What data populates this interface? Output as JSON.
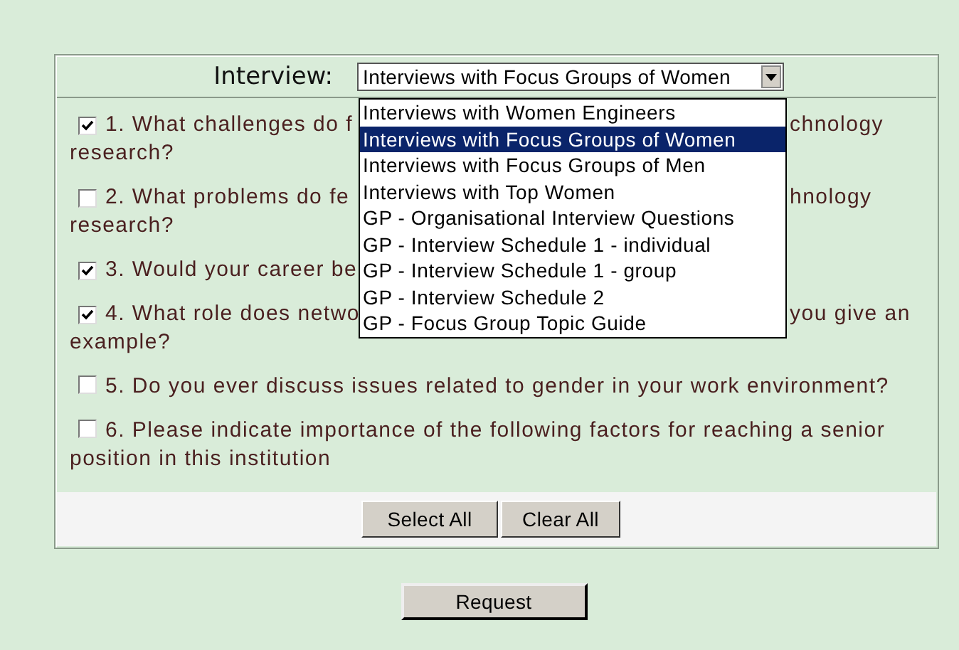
{
  "interview": {
    "label": "Interview:",
    "value": "Interviews with Focus Groups of Women",
    "expanded": true,
    "options": [
      {
        "label": "Interviews with Women Engineers",
        "selected": false
      },
      {
        "label": "Interviews with Focus Groups of Women",
        "selected": true
      },
      {
        "label": "Interviews with Focus Groups of Men",
        "selected": false
      },
      {
        "label": "Interviews with Top Women",
        "selected": false
      },
      {
        "label": "GP - Organisational Interview Questions",
        "selected": false
      },
      {
        "label": "GP - Interview Schedule 1 - individual",
        "selected": false
      },
      {
        "label": "GP - Interview Schedule 1 - group",
        "selected": false
      },
      {
        "label": "GP - Interview Schedule 2",
        "selected": false
      },
      {
        "label": "GP - Focus Group Topic Guide",
        "selected": false
      }
    ]
  },
  "questions": [
    {
      "checked": true,
      "kind": "covered",
      "visible_start": "1. What challenges do f",
      "visible_end": "chnology",
      "continuation": "research?"
    },
    {
      "checked": false,
      "kind": "covered",
      "visible_start": "2. What problems do fe",
      "visible_end": "hnology",
      "continuation": "research?"
    },
    {
      "checked": true,
      "kind": "covered",
      "visible_start": "3. Would your career be"
    },
    {
      "checked": true,
      "kind": "covered",
      "visible_start": "4. What role does netwo",
      "visible_end": "you give an",
      "continuation": "example?"
    },
    {
      "checked": false,
      "kind": "full",
      "text": "5. Do you ever discuss issues related to gender in your work environment?"
    },
    {
      "checked": false,
      "kind": "full",
      "text": "6. Please indicate importance of the following factors for reaching a senior position in this institution"
    }
  ],
  "buttons": [
    "Select All",
    "Clear All"
  ],
  "submit": "Request"
}
